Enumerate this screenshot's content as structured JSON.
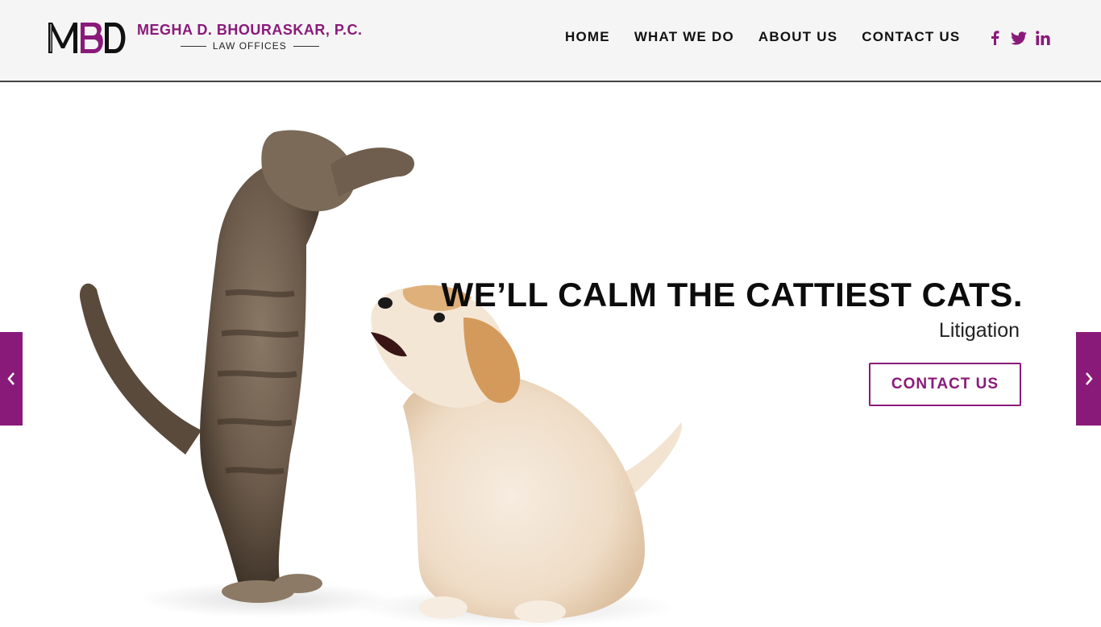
{
  "brand": {
    "mark": "MBD",
    "name": "MEGHA D. BHOURASKAR, P.C.",
    "subtitle": "LAW OFFICES",
    "accent_color": "#8a1a7a"
  },
  "nav": {
    "items": [
      {
        "label": "HOME"
      },
      {
        "label": "WHAT WE DO"
      },
      {
        "label": "ABOUT US"
      },
      {
        "label": "CONTACT US"
      }
    ]
  },
  "social": {
    "icons": [
      "facebook-icon",
      "twitter-icon",
      "linkedin-icon"
    ]
  },
  "hero": {
    "headline": "WE’LL CALM THE CATTIEST CATS.",
    "subheadline": "Litigation",
    "cta_label": "CONTACT US",
    "prev_icon": "chevron-left-icon",
    "next_icon": "chevron-right-icon"
  }
}
